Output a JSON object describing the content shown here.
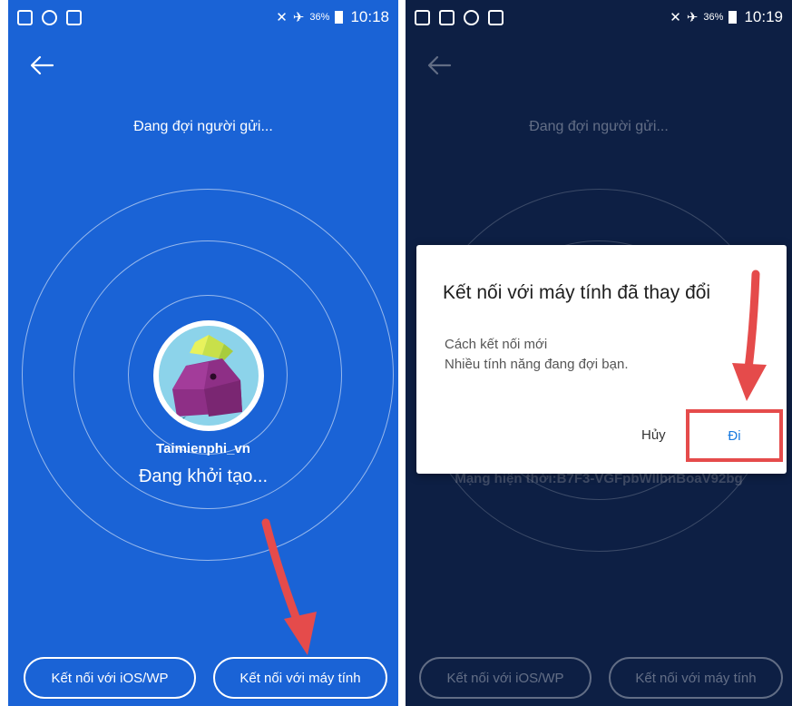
{
  "left_screen": {
    "status_time": "10:18",
    "status_battery": "36%",
    "waiting_text": "Đang đợi người gửi...",
    "username": "Taimienphi_vn",
    "init_status": "Đang khởi tạo...",
    "btn_ios": "Kết nối với iOS/WP",
    "btn_pc": "Kết nối với máy tính",
    "colors": {
      "background": "#1a63d6",
      "arrow": "#e54b4b"
    }
  },
  "right_screen": {
    "status_time": "10:19",
    "status_battery": "36%",
    "waiting_text": "Đang đợi người gửi...",
    "network_text": "Mạng hiện thời:B7F3-VGFpbWllbnBoaV92bg",
    "btn_ios": "Kết nối với iOS/WP",
    "btn_pc": "Kết nối với máy tính",
    "dialog": {
      "title": "Kết nối với máy tính đã thay đổi",
      "message_line1": "Cách kết nối mới",
      "message_line2": "Nhiều tính năng đang đợi bạn.",
      "cancel_label": "Hủy",
      "go_label": "Đi"
    },
    "colors": {
      "background": "#0d1f44",
      "highlight": "#e54b4b",
      "link": "#1a7be0"
    }
  }
}
